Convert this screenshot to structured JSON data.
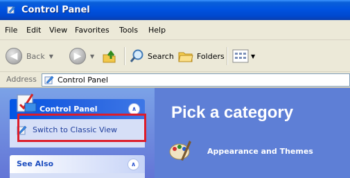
{
  "window": {
    "title": "Control Panel"
  },
  "menu": [
    {
      "label": "File"
    },
    {
      "label": "Edit"
    },
    {
      "label": "View"
    },
    {
      "label": "Favorites"
    },
    {
      "label": "Tools"
    },
    {
      "label": "Help"
    }
  ],
  "toolbar": {
    "back_label": "Back",
    "search_label": "Search",
    "folders_label": "Folders"
  },
  "address": {
    "label": "Address",
    "value": "Control Panel"
  },
  "left_pane": {
    "panel_title": "Control Panel",
    "switch_link": "Switch to Classic View",
    "see_also_title": "See Also"
  },
  "right_pane": {
    "heading": "Pick a category",
    "categories": [
      {
        "label": "Appearance and Themes",
        "icon": "appearance-themes-icon"
      }
    ]
  },
  "colors": {
    "titlebar": "#0053e0",
    "task_pane": "#7ba2e7",
    "category_pane": "#5e7fd6",
    "highlight_box": "#dd1c2a"
  }
}
